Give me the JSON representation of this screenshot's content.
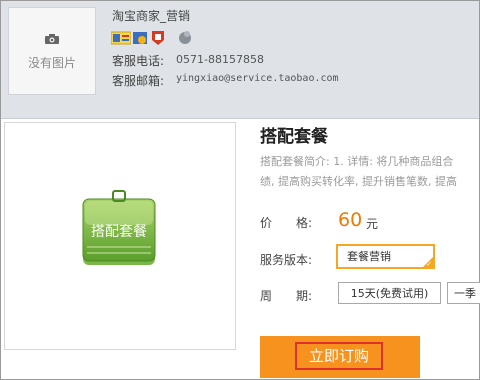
{
  "seller": {
    "no_image_text": "没有图片",
    "name": "淘宝商家_营销",
    "phone_label": "客服电话:",
    "phone": "0571-88157858",
    "email_label": "客服邮箱:",
    "email": "yingxiao@service.taobao.com"
  },
  "product": {
    "image_label": "搭配套餐",
    "title": "搭配套餐",
    "intro_line1": "搭配套餐简介: 1. 详情: 将几种商品组合",
    "intro_line2": "绩, 提高购买转化率, 提升销售笔数, 提高",
    "price_label": "价　　格:",
    "price": "60",
    "price_unit": "元",
    "version_label": "服务版本:",
    "version_selected": "套餐营销",
    "period_label": "周　　期:",
    "periods": [
      "15天(免费试用)",
      "一季"
    ],
    "buy_label": "立即订购"
  },
  "colors": {
    "accent": "#f7921e",
    "price": "#f07a00",
    "selected_border": "#f5a623",
    "buy_border": "#e0302a"
  }
}
